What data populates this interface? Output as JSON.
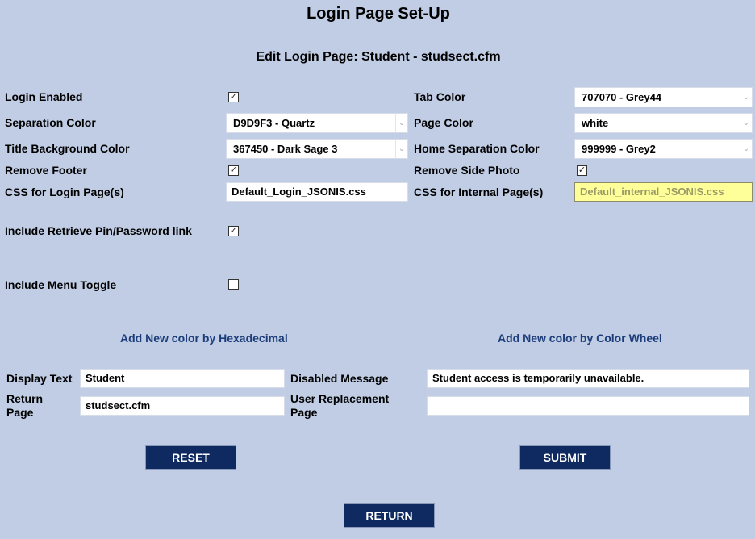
{
  "page": {
    "title": "Login Page Set-Up",
    "subtitle": "Edit Login Page: Student - studsect.cfm"
  },
  "settings": {
    "login_enabled": {
      "label": "Login Enabled",
      "checked": true
    },
    "tab_color": {
      "label": "Tab Color",
      "value": "707070 - Grey44"
    },
    "separation_color": {
      "label": "Separation Color",
      "value": "D9D9F3 - Quartz"
    },
    "page_color": {
      "label": "Page Color",
      "value": "white"
    },
    "title_bg_color": {
      "label": "Title Background Color",
      "value": "367450 - Dark Sage 3"
    },
    "home_separation_color": {
      "label": "Home Separation Color",
      "value": "999999 - Grey2"
    },
    "remove_footer": {
      "label": "Remove Footer",
      "checked": true
    },
    "remove_side_photo": {
      "label": "Remove Side Photo",
      "checked": true
    },
    "css_login": {
      "label": "CSS for Login Page(s)",
      "value": "Default_Login_JSONIS.css"
    },
    "css_internal": {
      "label": "CSS for Internal Page(s)",
      "value": "Default_internal_JSONIS.css"
    },
    "retrieve_pin": {
      "label": "Include Retrieve Pin/Password link",
      "checked": true
    },
    "menu_toggle": {
      "label": "Include Menu Toggle",
      "checked": false
    }
  },
  "links": {
    "hex": "Add New color by Hexadecimal",
    "wheel": "Add New color by Color Wheel"
  },
  "form": {
    "display_text": {
      "label": "Display Text",
      "value": "Student"
    },
    "return_page": {
      "label_line1": "Return",
      "label_line2": "Page",
      "value": "studsect.cfm"
    },
    "disabled_message": {
      "label": "Disabled Message",
      "value": "Student access is temporarily unavailable."
    },
    "user_replacement": {
      "label_line1": "User Replacement",
      "label_line2": "Page",
      "value": ""
    }
  },
  "buttons": {
    "reset": "RESET",
    "submit": "SUBMIT",
    "return": "RETURN"
  },
  "icons": {
    "check": "✓",
    "chevron": "⌄"
  }
}
